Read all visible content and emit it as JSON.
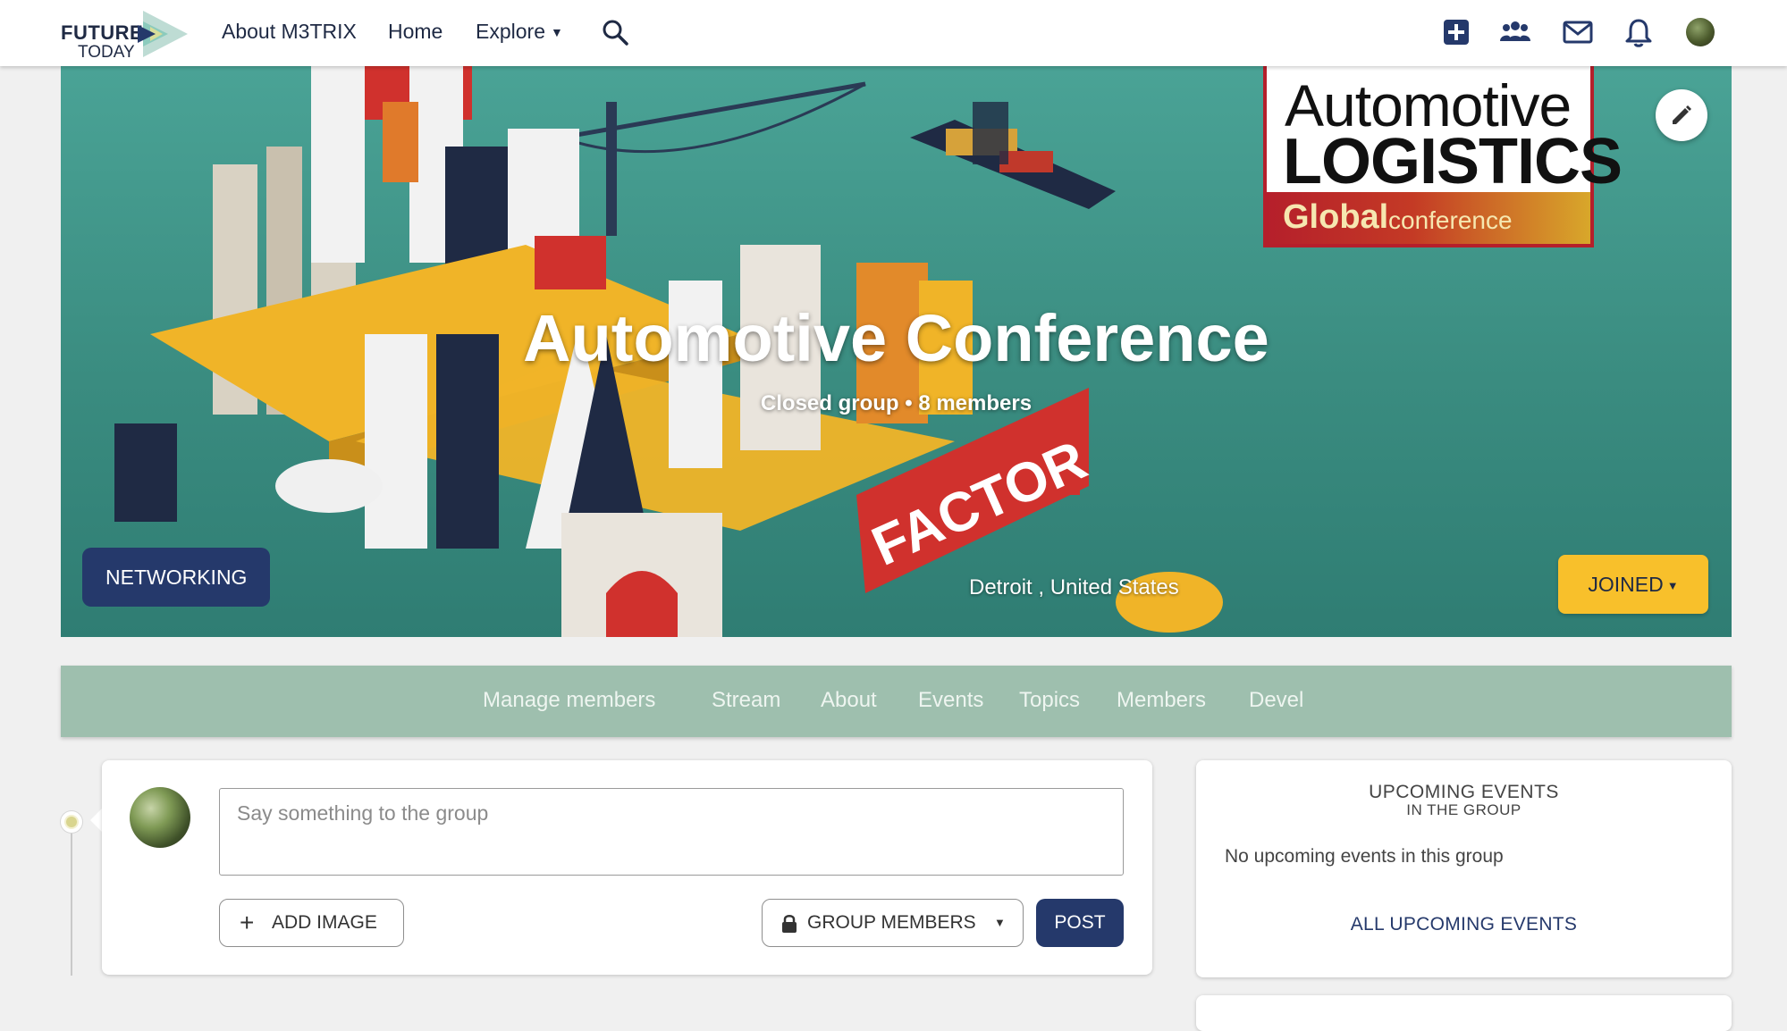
{
  "topnav": {
    "logo_line1": "FUTURE",
    "logo_line2": "TODAY",
    "links": [
      {
        "label": "About M3TRIX"
      },
      {
        "label": "Home"
      },
      {
        "label": "Explore"
      }
    ],
    "icons": [
      "search-icon",
      "create-post-icon",
      "groups-icon",
      "messages-icon",
      "notifications-icon",
      "avatar"
    ]
  },
  "hero": {
    "title": "Automotive Conference",
    "subtitle": "Closed group • 8 members",
    "sponsor_line1": "Automotive",
    "sponsor_line2": "LOGISTICS",
    "sponsor_line3": "Global",
    "sponsor_line4": "conference",
    "category_tag": "NETWORKING",
    "location": "Detroit , United States",
    "joined_button": "JOINED"
  },
  "group_tabs": [
    {
      "label": "Manage members"
    },
    {
      "label": "Stream"
    },
    {
      "label": "About"
    },
    {
      "label": "Events"
    },
    {
      "label": "Topics"
    },
    {
      "label": "Members"
    },
    {
      "label": "Devel"
    }
  ],
  "composer": {
    "placeholder": "Say something to the group",
    "add_image_label": "ADD IMAGE",
    "visibility_label": "GROUP MEMBERS",
    "post_label": "POST"
  },
  "upcoming_events": {
    "heading": "UPCOMING EVENTS",
    "subheading": "IN THE GROUP",
    "empty_text": "No upcoming events in this group",
    "all_link": "ALL UPCOMING EVENTS"
  },
  "colors": {
    "navy": "#25396b",
    "joined_yellow": "#f8c02b",
    "tabs_bg": "#9ebfae",
    "hero_teal": "#3a8c80"
  }
}
